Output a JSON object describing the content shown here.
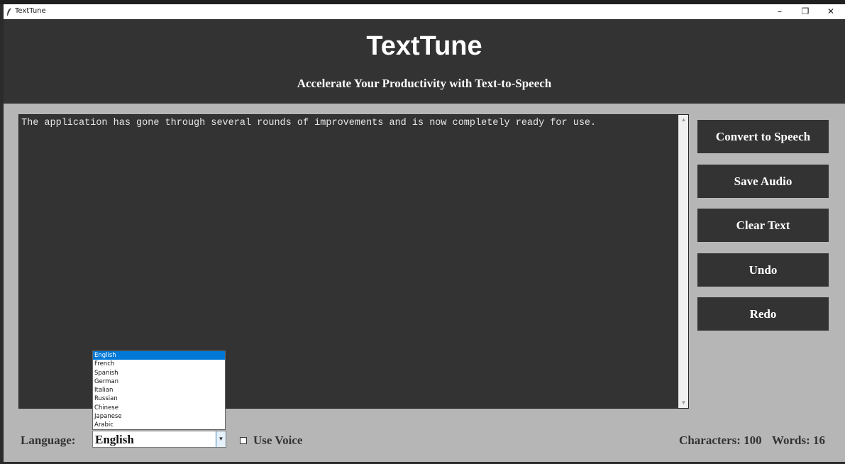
{
  "window": {
    "title": "TextTune",
    "minimize_glyph": "–",
    "maximize_glyph": "❐",
    "close_glyph": "✕"
  },
  "header": {
    "app_name": "TextTune",
    "tagline": "Accelerate Your Productivity with Text-to-Speech"
  },
  "editor": {
    "text": "The application has gone through several rounds of improvements and is now completely ready for use."
  },
  "actions": [
    {
      "label": "Convert to Speech"
    },
    {
      "label": "Save Audio"
    },
    {
      "label": "Clear Text"
    },
    {
      "label": "Undo"
    },
    {
      "label": "Redo"
    }
  ],
  "language": {
    "label": "Language:",
    "selected": "English",
    "options": [
      "English",
      "French",
      "Spanish",
      "German",
      "Italian",
      "Russian",
      "Chinese",
      "Japanese",
      "Arabic"
    ]
  },
  "voice": {
    "label": "Use Voice",
    "checked": false
  },
  "stats": {
    "characters": "Characters: 100",
    "words": "Words: 16"
  },
  "colors": {
    "header_bg": "#333333",
    "panel_bg": "#b6b6b6",
    "button_bg": "#333333",
    "selection": "#0078d7"
  }
}
